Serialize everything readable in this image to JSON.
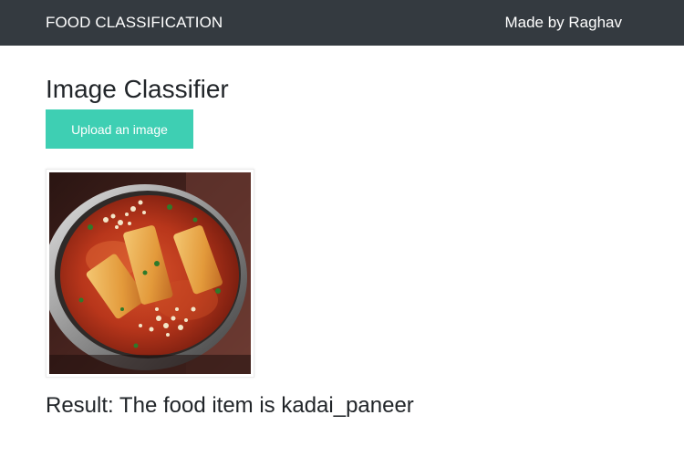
{
  "navbar": {
    "brand": "FOOD CLASSIFICATION",
    "credit": "Made by Raghav",
    "background": "#343a40"
  },
  "main": {
    "title": "Image Classifier",
    "upload_label": "Upload an image",
    "upload_color": "#3ecfb3",
    "image_alt_subject": "kadai paneer dish in a steel bowl",
    "result_text": "Result: The food item is kadai_paneer"
  }
}
